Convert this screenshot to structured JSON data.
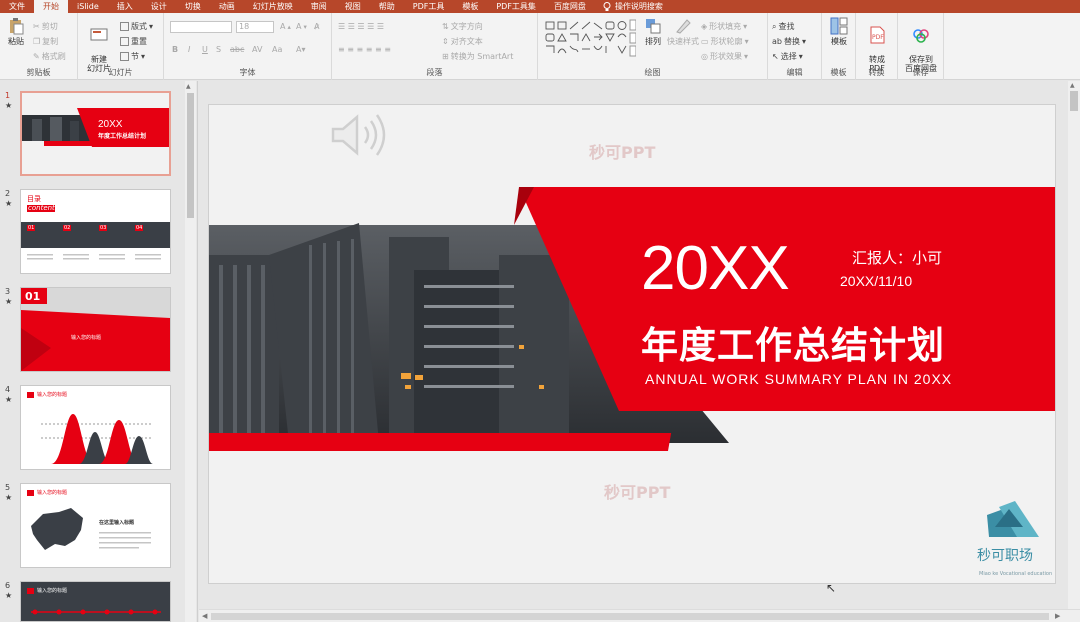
{
  "tabs": [
    "文件",
    "开始",
    "iSlide",
    "插入",
    "设计",
    "切换",
    "动画",
    "幻灯片放映",
    "审阅",
    "视图",
    "帮助",
    "PDF工具",
    "模板",
    "PDF工具集",
    "百度网盘"
  ],
  "active_tab": 1,
  "tell_me": "操作说明搜索",
  "ribbon": {
    "clipboard": {
      "label": "剪贴板",
      "paste": "粘贴",
      "cut": "剪切",
      "copy": "复制",
      "format_painter": "格式刷"
    },
    "slides": {
      "label": "幻灯片",
      "new_slide": "新建\n幻灯片",
      "layout": "版式",
      "reset": "重置",
      "section": "节"
    },
    "font": {
      "label": "字体",
      "font_size": "18"
    },
    "paragraph": {
      "label": "段落",
      "text_direction": "文字方向",
      "align_text": "对齐文本",
      "smartart": "转换为 SmartArt"
    },
    "drawing": {
      "label": "绘图",
      "arrange": "排列",
      "quick_styles": "快速样式",
      "shape_fill": "形状填充",
      "shape_outline": "形状轮廓",
      "shape_effects": "形状效果"
    },
    "editing": {
      "label": "编辑",
      "find": "查找",
      "replace": "替换",
      "select": "选择"
    },
    "template": {
      "label": "模板",
      "btn": "模板"
    },
    "convert": {
      "label": "转换",
      "btn": "转成\nPDF"
    },
    "save": {
      "label": "保存",
      "btn": "保存到\n百度网盘"
    }
  },
  "thumbnails": [
    {
      "num": "1",
      "star": "★",
      "title": "20XX",
      "subtitle": "年度工作总结计划"
    },
    {
      "num": "2",
      "star": "★",
      "title": "目录",
      "subtitle": "content",
      "items": [
        "01",
        "02",
        "03",
        "04"
      ]
    },
    {
      "num": "3",
      "star": "★",
      "title": "01",
      "subtitle": "输入您的标题"
    },
    {
      "num": "4",
      "star": "★",
      "title": "输入您的标题"
    },
    {
      "num": "5",
      "star": "★",
      "title": "输入您的标题",
      "subtitle": "在这里输入标题"
    },
    {
      "num": "6",
      "star": "★",
      "title": "输入您的标题"
    }
  ],
  "slide": {
    "watermark1": "秒可PPT",
    "watermark2": "秒可PPT",
    "year": "20XX",
    "reporter": "汇报人：小可",
    "date": "20XX/11/10",
    "main_title": "年度工作总结计划",
    "subtitle_en": "ANNUAL WORK SUMMARY PLAN IN 20XX",
    "logo_text": "秒可职场",
    "logo_sub": "Miao ke Vocational education"
  },
  "colors": {
    "accent": "#b7472a",
    "slide_red": "#e60012"
  }
}
